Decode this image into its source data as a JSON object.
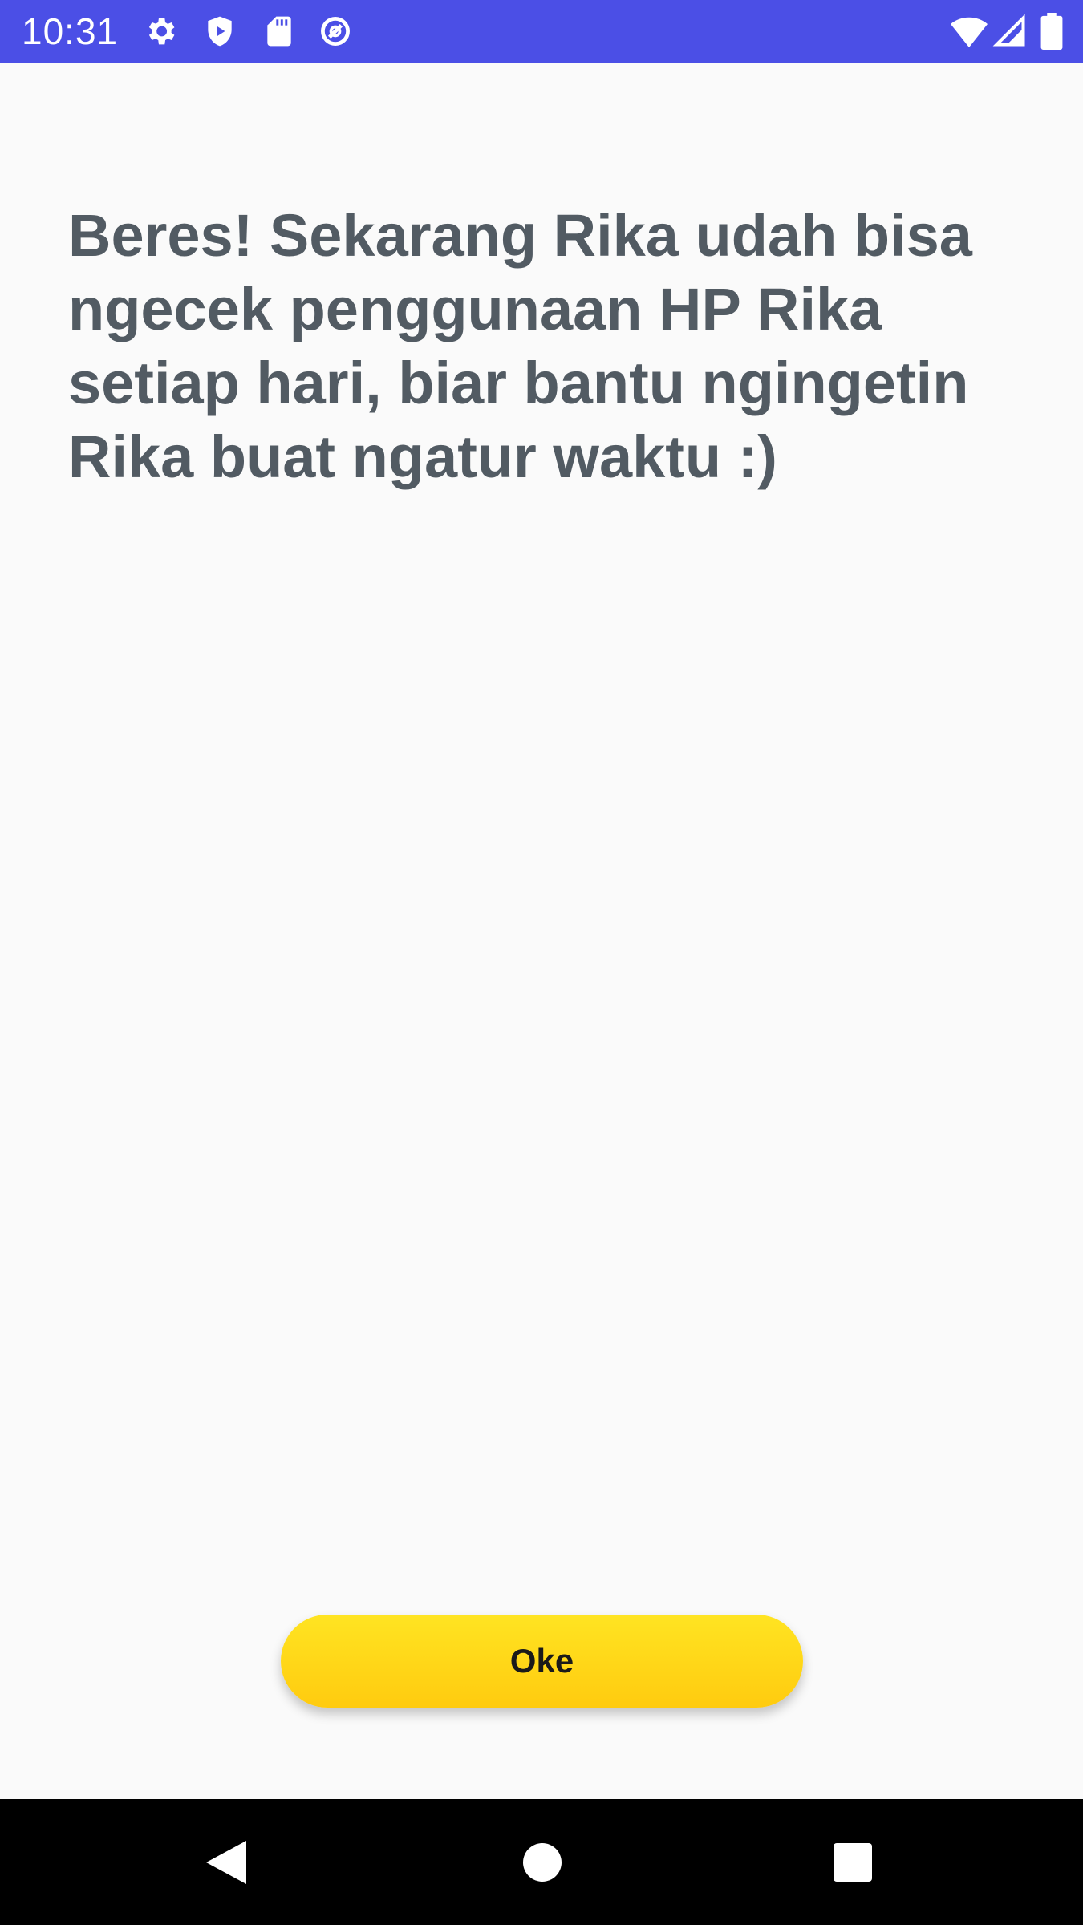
{
  "status_bar": {
    "time": "10:31",
    "background_color": "#4B4FE6",
    "left_icons": [
      "settings-gear-icon",
      "play-protect-shield-icon",
      "sd-card-icon",
      "data-saver-icon"
    ],
    "right_icons": [
      "wifi-icon",
      "cell-signal-icon",
      "battery-icon"
    ]
  },
  "main": {
    "message": "Beres! Sekarang Rika udah bisa ngecek penggunaan HP Rika setiap hari, biar bantu ngingetin Rika buat ngatur waktu :)",
    "ok_button_label": "Oke",
    "button_color": "#FFD816",
    "text_color": "#525B63"
  },
  "nav_bar": {
    "icons": [
      "back-icon",
      "home-icon",
      "recents-icon"
    ]
  }
}
